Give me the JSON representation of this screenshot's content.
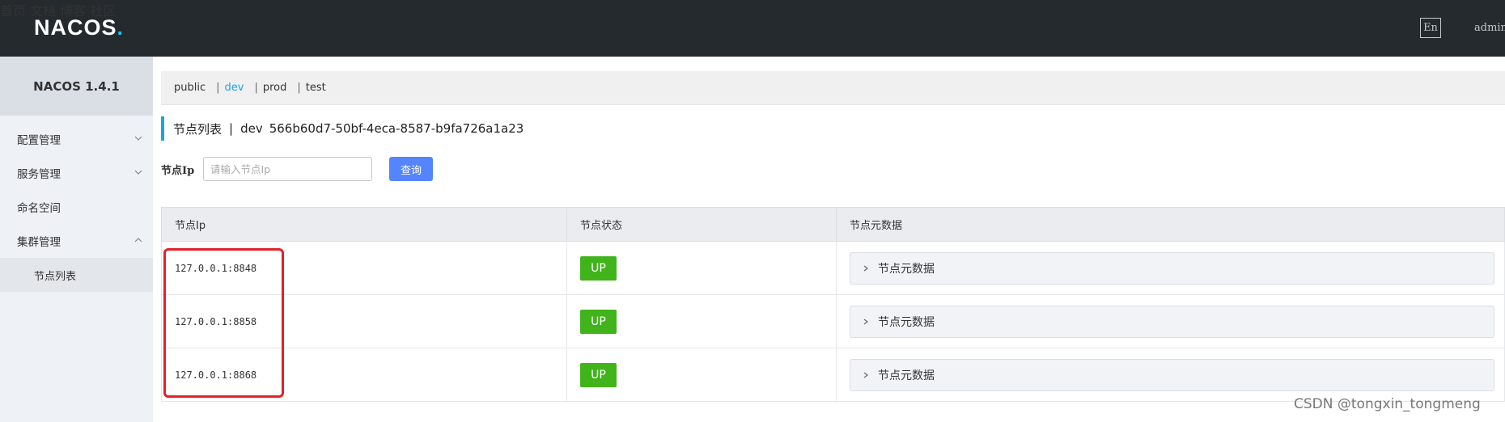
{
  "header": {
    "logo": {
      "pre": "NA",
      "mid": "COS",
      "dot": "."
    },
    "nav": [
      "首页",
      "文档",
      "博客",
      "社区"
    ],
    "lang": "En",
    "user": "admin"
  },
  "sidebar": {
    "title": "NACOS 1.4.1",
    "items": [
      {
        "label": "配置管理",
        "icon": "chevron-down-icon"
      },
      {
        "label": "服务管理",
        "icon": "chevron-down-icon"
      },
      {
        "label": "命名空间"
      },
      {
        "label": "集群管理",
        "icon": "chevron-up-icon"
      }
    ],
    "sub_items": [
      "节点列表"
    ]
  },
  "namespaces": {
    "items": [
      "public",
      "dev",
      "prod",
      "test"
    ],
    "separator": "|",
    "active": "dev"
  },
  "page_title": {
    "title": "节点列表",
    "separator": "|",
    "namespace_name": "dev",
    "namespace_id": "566b60d7-50bf-4eca-8587-b9fa726a1a23"
  },
  "search": {
    "label": "节点Ip",
    "placeholder": "请输入节点Ip",
    "button": "查询"
  },
  "table": {
    "headers": [
      "节点Ip",
      "节点状态",
      "节点元数据"
    ],
    "rows": [
      {
        "ip": "127.0.0.1:8848",
        "status": "UP",
        "meta": "节点元数据"
      },
      {
        "ip": "127.0.0.1:8858",
        "status": "UP",
        "meta": "节点元数据"
      },
      {
        "ip": "127.0.0.1:8868",
        "status": "UP",
        "meta": "节点元数据"
      }
    ]
  },
  "watermark": "CSDN @tongxin_tongmeng",
  "colors": {
    "topbar": "#252a2f",
    "accent": "#1ca1e3",
    "primary_button": "#5584ff",
    "status_up": "#41b41b",
    "highlight": "#e0222b"
  }
}
